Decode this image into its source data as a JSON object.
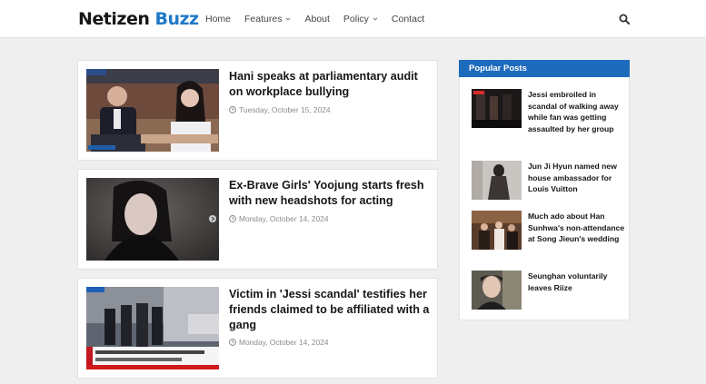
{
  "header": {
    "logo_part1": "Netizen",
    "logo_part2": "Buzz",
    "nav": [
      {
        "label": "Home",
        "has_dropdown": false
      },
      {
        "label": "Features",
        "has_dropdown": true
      },
      {
        "label": "About",
        "has_dropdown": false
      },
      {
        "label": "Policy",
        "has_dropdown": true
      },
      {
        "label": "Contact",
        "has_dropdown": false
      }
    ],
    "search_icon": "search-icon",
    "accent_color": "#1e78c8"
  },
  "posts": [
    {
      "title": "Hani speaks at parliamentary audit on workplace bullying",
      "date": "Tuesday, October 15, 2024"
    },
    {
      "title": "Ex-Brave Girls' Yoojung starts fresh with new headshots for acting",
      "date": "Monday, October 14, 2024"
    },
    {
      "title": "Victim in 'Jessi scandal' testifies her friends claimed to be affiliated with a gang",
      "date": "Monday, October 14, 2024"
    }
  ],
  "sidebar": {
    "heading": "Popular Posts",
    "heading_color": "#1d6bbd",
    "items": [
      {
        "title": "Jessi embroiled in scandal of walking away while fan was getting assaulted by her group"
      },
      {
        "title": "Jun Ji Hyun named new house ambassador for Louis Vuitton"
      },
      {
        "title": "Much ado about Han Sunhwa's non-attendance at Song Jieun's wedding"
      },
      {
        "title": "Seunghan voluntarily leaves Riize"
      }
    ]
  }
}
